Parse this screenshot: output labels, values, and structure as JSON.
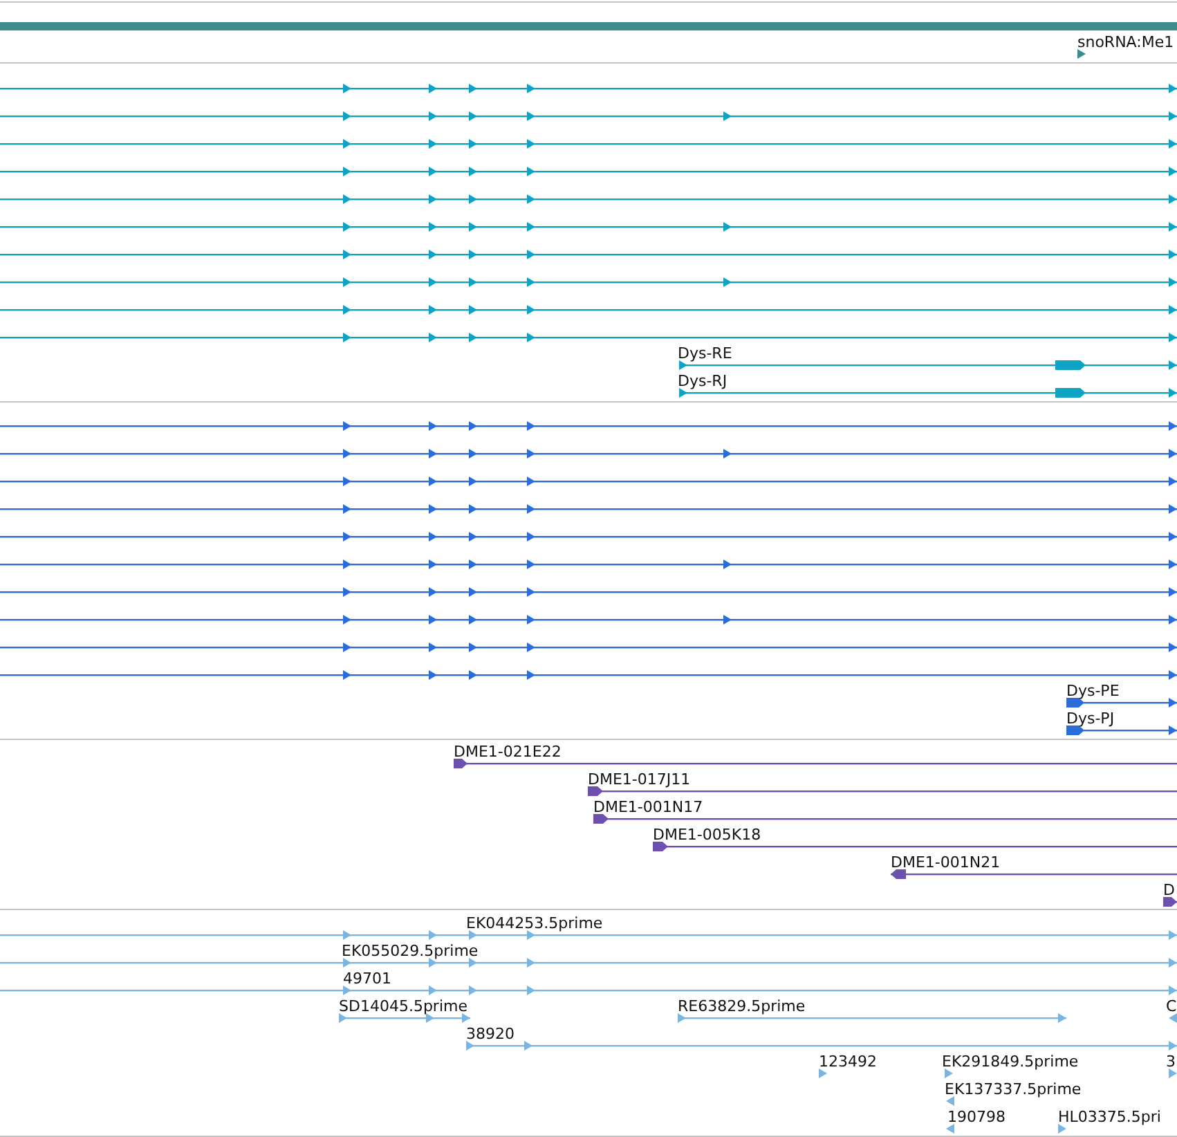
{
  "tracks": [
    {
      "kind": "ncrna",
      "features": [
        {
          "label": "snoRNA:Me1",
          "reverse": false
        }
      ]
    },
    {
      "kind": "transcript",
      "features": [
        {
          "reverse": false
        },
        {
          "reverse": false
        },
        {
          "reverse": false
        },
        {
          "reverse": false
        },
        {
          "reverse": false
        },
        {
          "reverse": false
        },
        {
          "reverse": false
        },
        {
          "reverse": false
        },
        {
          "reverse": false
        },
        {
          "reverse": false
        },
        {
          "label": "Dys-RE",
          "reverse": false
        },
        {
          "label": "Dys-RJ",
          "reverse": false
        }
      ]
    },
    {
      "kind": "polypeptide",
      "features": [
        {
          "reverse": false
        },
        {
          "reverse": false
        },
        {
          "reverse": false
        },
        {
          "reverse": false
        },
        {
          "reverse": false
        },
        {
          "reverse": false
        },
        {
          "reverse": false
        },
        {
          "reverse": false
        },
        {
          "reverse": false
        },
        {
          "reverse": false
        },
        {
          "label": "Dys-PE",
          "reverse": false
        },
        {
          "label": "Dys-PJ",
          "reverse": false
        }
      ]
    },
    {
      "kind": "clone",
      "features": [
        {
          "label": "DME1-021E22",
          "reverse": false
        },
        {
          "label": "DME1-017J11",
          "reverse": false
        },
        {
          "label": "DME1-001N17",
          "reverse": false
        },
        {
          "label": "DME1-005K18",
          "reverse": false
        },
        {
          "label": "DME1-001N21",
          "reverse": true
        },
        {
          "label": "D",
          "reverse": false
        }
      ]
    },
    {
      "kind": "est",
      "features": [
        {
          "label": "EK044253.5prime",
          "reverse": false
        },
        {
          "label": "EK055029.5prime",
          "reverse": false
        },
        {
          "label": "49701",
          "reverse": false
        },
        {
          "label": "SD14045.5prime",
          "reverse": false
        },
        {
          "label": "RE63829.5prime",
          "reverse": false
        },
        {
          "label": "C",
          "reverse": true
        },
        {
          "label": "38920",
          "reverse": false
        },
        {
          "label": "123492",
          "reverse": false
        },
        {
          "label": "EK291849.5prime",
          "reverse": false
        },
        {
          "label": "3",
          "reverse": false
        },
        {
          "label": "EK137337.5prime",
          "reverse": true
        },
        {
          "label": "190798",
          "reverse": true
        },
        {
          "label": "HL03375.5pri",
          "reverse": false
        }
      ]
    }
  ]
}
